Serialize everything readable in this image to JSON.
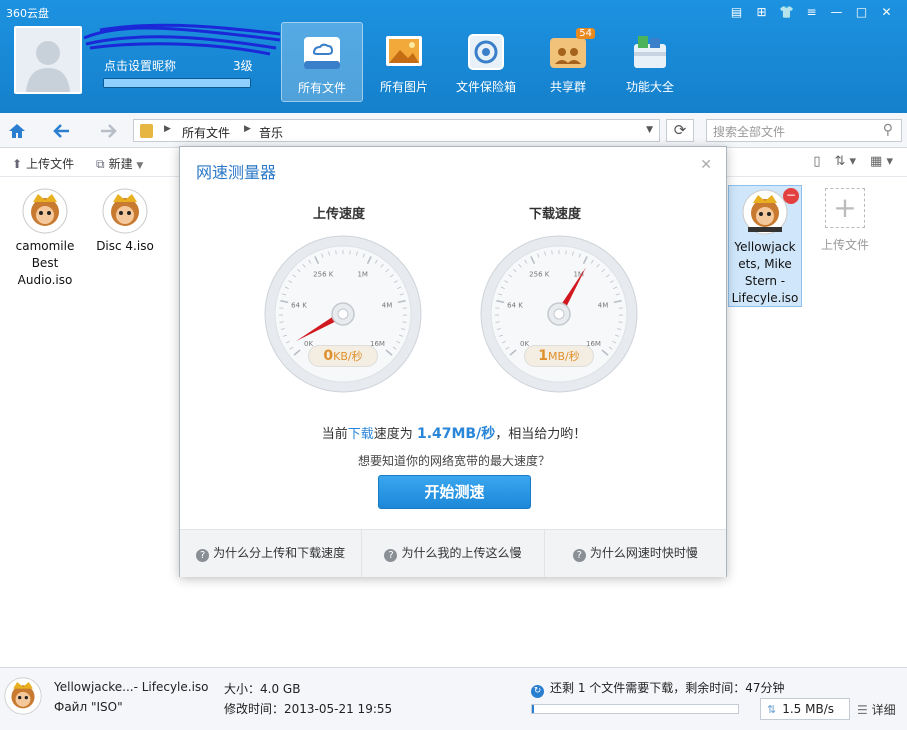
{
  "app": {
    "title": "360云盘"
  },
  "window_controls": [
    "▤",
    "⊞",
    "👕",
    "≡",
    "—",
    "□",
    "✕"
  ],
  "user": {
    "nickname": "点击设置昵称",
    "level": "3级",
    "level_progress": 1.0
  },
  "nav": [
    {
      "label": "所有文件",
      "icon": "cloud-drive-icon",
      "active": true
    },
    {
      "label": "所有图片",
      "icon": "photos-icon"
    },
    {
      "label": "文件保险箱",
      "icon": "safe-icon"
    },
    {
      "label": "共享群",
      "icon": "share-group-icon",
      "badge": "54"
    },
    {
      "label": "功能大全",
      "icon": "toolbox-icon"
    }
  ],
  "toolbar": {
    "breadcrumb": [
      "所有文件",
      "音乐"
    ],
    "search_placeholder": "搜索全部文件"
  },
  "actions": {
    "upload": "上传文件",
    "new": "新建"
  },
  "files": [
    {
      "name": "camomile Best Audio.iso",
      "lines": [
        "camomile",
        "Best",
        "Audio.iso"
      ]
    },
    {
      "name": "Disc 4.iso",
      "lines": [
        "Disc 4.iso"
      ]
    },
    {
      "name": "Yellowjackets, Mike Stern - Lifecyle.iso",
      "lines": [
        "Yellowjack",
        "ets, Mike",
        "Stern -",
        "Lifecyle.iso"
      ],
      "selected": true
    }
  ],
  "upload_tile": {
    "label": "上传文件"
  },
  "dialog": {
    "title": "网速测量器",
    "upload_title": "上传速度",
    "download_title": "下载速度",
    "gauge_ticks": [
      "0K",
      "64 K",
      "256 K",
      "1M",
      "4M",
      "16M"
    ],
    "upload_value": "0",
    "upload_unit": "KB/秒",
    "download_value": "1",
    "download_unit": "MB/秒",
    "result_prefix": "当前",
    "result_hl": "下载",
    "result_mid": "速度为",
    "result_num": "1.47MB/秒",
    "result_suffix": "，相当给力哟！",
    "hint": "想要知道你的网络宽带的最大速度？",
    "start_button": "开始测速",
    "faq": [
      "为什么分上传和下载速度",
      "为什么我的上传这么慢",
      "为什么网速时快时慢"
    ]
  },
  "status": {
    "filename": "Yellowjacke...- Lifecyle.iso",
    "filetype": "Файл \"ISO\"",
    "size": "大小：4.0 GB",
    "modified": "修改时间：2013-05-21 19:55",
    "download_info": "还剩 1 个文件需要下载，剩余时间：47分钟",
    "download_progress": 0.01,
    "rate": "1.5 MB/s",
    "detail": "详细"
  },
  "colors": {
    "header": "#1d92e0",
    "accent": "#2a86d8",
    "needle": "#d0181e",
    "speed_text": "#e0902a"
  }
}
